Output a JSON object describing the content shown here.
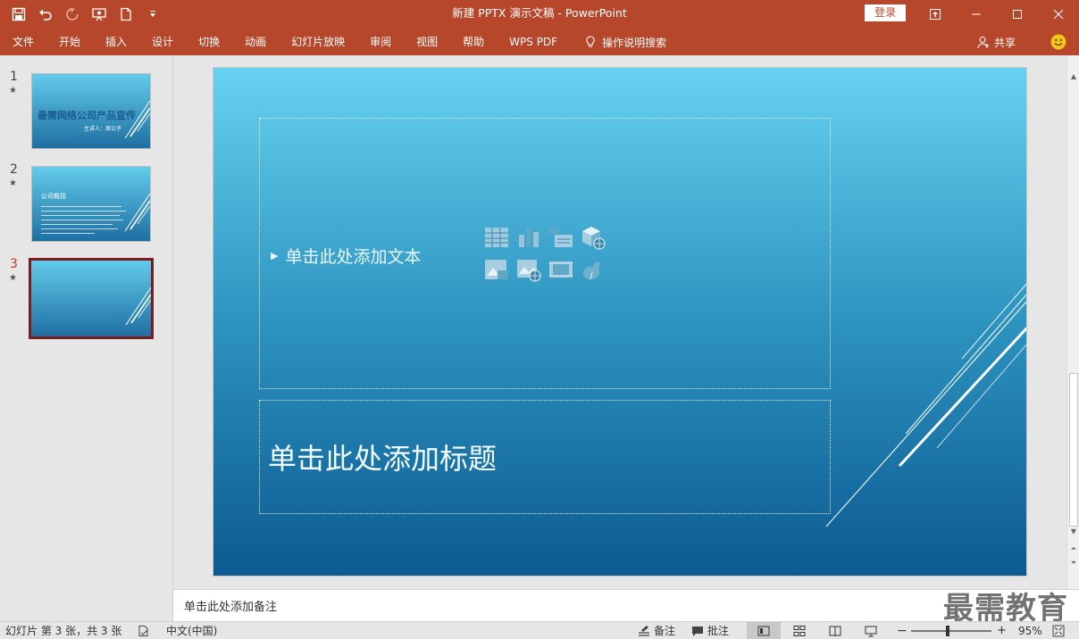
{
  "titlebar": {
    "title": "新建 PPTX 演示文稿  -  PowerPoint",
    "login_label": "登录",
    "color": "#b7472a"
  },
  "qat": {
    "items": [
      {
        "icon": "save-icon"
      },
      {
        "icon": "undo-icon"
      },
      {
        "icon": "redo-icon"
      },
      {
        "icon": "slideshow-from-start-icon"
      },
      {
        "icon": "new-file-icon"
      },
      {
        "icon": "customize-qat-icon"
      }
    ]
  },
  "window_controls": [
    "ribbon-display-options-icon",
    "minimize-icon",
    "maximize-icon",
    "close-icon"
  ],
  "ribbon": {
    "tabs": [
      "文件",
      "开始",
      "插入",
      "设计",
      "切换",
      "动画",
      "幻灯片放映",
      "审阅",
      "视图",
      "帮助",
      "WPS PDF"
    ],
    "tell_me": "操作说明搜索",
    "share": "共享"
  },
  "thumbnails": {
    "slides": [
      {
        "number": "1",
        "star": "★",
        "title": "最需网络公司产品宣传",
        "subtitle": "主讲人：周公子"
      },
      {
        "number": "2",
        "star": "★",
        "heading": "公司概括"
      },
      {
        "number": "3",
        "star": "★"
      }
    ],
    "selected": 3
  },
  "slide": {
    "content_placeholder": "单击此处添加文本",
    "title_placeholder": "单击此处添加标题",
    "insert_icons": [
      "insert-table-icon",
      "insert-chart-icon",
      "insert-smartart-icon",
      "insert-3d-model-icon",
      "insert-picture-icon",
      "insert-online-picture-icon",
      "insert-video-icon",
      "insert-icons-icon"
    ]
  },
  "notes": {
    "placeholder": "单击此处添加备注"
  },
  "watermark": "最需教育",
  "statusbar": {
    "slide_info": "幻灯片 第 3 张，共 3 张",
    "language": "中文(中国)",
    "notes_label": "备注",
    "comments_label": "批注",
    "zoom_minus": "−",
    "zoom_plus": "+",
    "zoom": "95%"
  }
}
